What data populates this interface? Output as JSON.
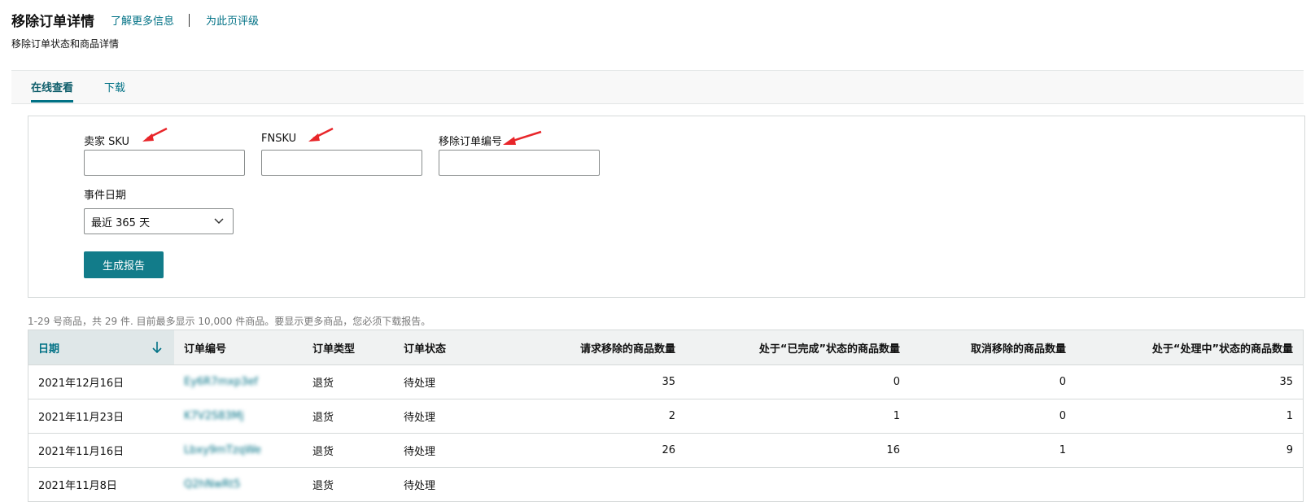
{
  "header": {
    "title": "移除订单详情",
    "learn_more": "了解更多信息",
    "rate_page": "为此页评级",
    "subtitle": "移除订单状态和商品详情"
  },
  "tabs": [
    {
      "label": "在线查看",
      "active": true
    },
    {
      "label": "下载",
      "active": false
    }
  ],
  "filters": {
    "seller_sku_label": "卖家 SKU",
    "fnsku_label": "FNSKU",
    "order_id_label": "移除订单编号",
    "event_date_label": "事件日期",
    "event_date_value": "最近 365 天",
    "generate_button": "生成报告"
  },
  "results_info": "1-29 号商品，共 29 件. 目前最多显示 10,000 件商品。要显示更多商品，您必须下载报告。",
  "table": {
    "headers": [
      "日期",
      "订单编号",
      "订单类型",
      "订单状态",
      "请求移除的商品数量",
      "处于“已完成”状态的商品数量",
      "取消移除的商品数量",
      "处于“处理中”状态的商品数量"
    ],
    "rows": [
      [
        "2021年12月16日",
        "Ey6R7mxp3ef",
        "退货",
        "待处理",
        "35",
        "0",
        "0",
        "35"
      ],
      [
        "2021年11月23日",
        "K7V2S83Mj",
        "退货",
        "待处理",
        "2",
        "1",
        "0",
        "1"
      ],
      [
        "2021年11月16日",
        "Lbxy9mTzqWe",
        "退货",
        "待处理",
        "26",
        "16",
        "1",
        "9"
      ],
      [
        "2021年11月8日",
        "Q2hNwRt5",
        "退货",
        "待处理",
        "",
        "",
        "",
        ""
      ]
    ]
  },
  "colors": {
    "link": "#007185",
    "primary_button": "#127c8a",
    "annotation_arrow": "#e8262a"
  }
}
